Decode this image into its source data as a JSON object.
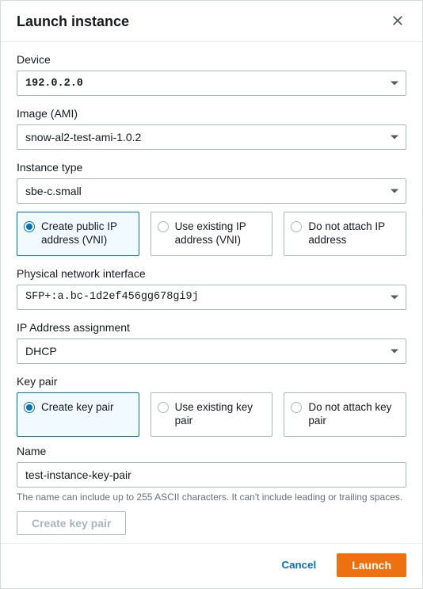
{
  "dialog": {
    "title": "Launch instance"
  },
  "device": {
    "label": "Device",
    "value": "192.0.2.0"
  },
  "image": {
    "label": "Image (AMI)",
    "value": "snow-al2-test-ami-1.0.2"
  },
  "instance_type": {
    "label": "Instance type",
    "value": "sbe-c.small"
  },
  "ip_options": [
    {
      "label": "Create public IP address (VNI)",
      "selected": true
    },
    {
      "label": "Use existing IP address (VNI)",
      "selected": false
    },
    {
      "label": "Do not attach IP address",
      "selected": false
    }
  ],
  "physical_interface": {
    "label": "Physical network interface",
    "value": "SFP+:a.bc-1d2ef456gg678gi9j"
  },
  "ip_assignment": {
    "label": "IP Address assignment",
    "value": "DHCP"
  },
  "key_pair": {
    "label": "Key pair",
    "options": [
      {
        "label": "Create key pair",
        "selected": true
      },
      {
        "label": "Use existing key pair",
        "selected": false
      },
      {
        "label": "Do not attach key pair",
        "selected": false
      }
    ],
    "name_label": "Name",
    "name_value": "test-instance-key-pair",
    "hint": "The name can include up to 255 ASCII characters. It can't include leading or trailing spaces.",
    "create_button": "Create key pair"
  },
  "footer": {
    "cancel": "Cancel",
    "launch": "Launch"
  }
}
